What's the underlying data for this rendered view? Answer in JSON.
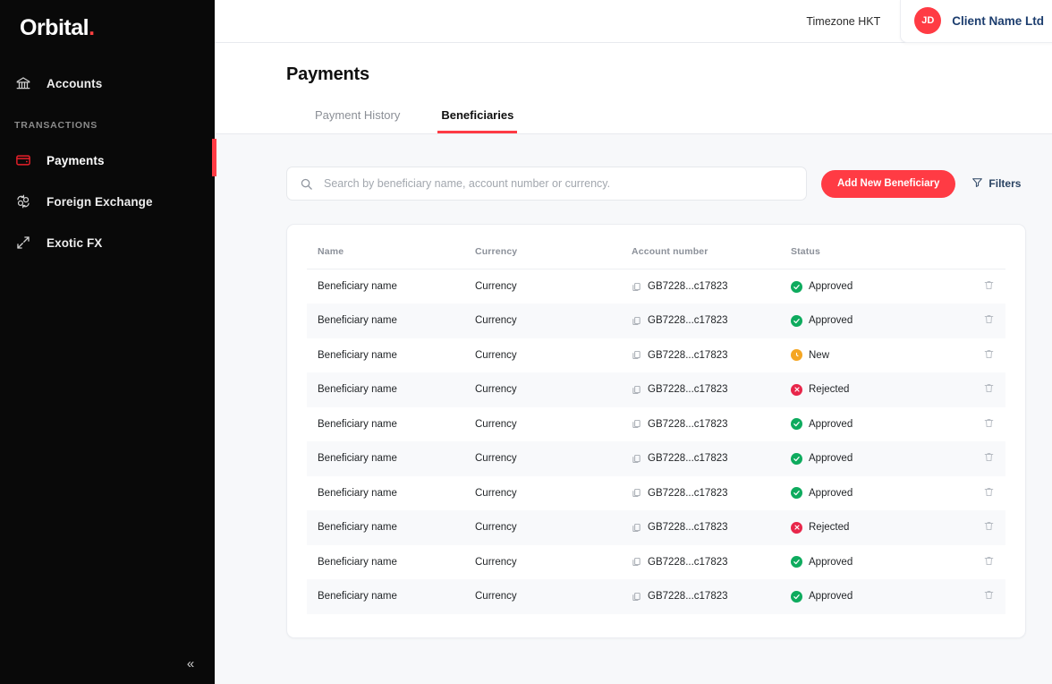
{
  "brand": {
    "name": "Orbital",
    "dot": "."
  },
  "sidebar": {
    "section_label": "TRANSACTIONS",
    "items": [
      {
        "label": "Accounts",
        "icon": "bank-icon"
      },
      {
        "label": "Payments",
        "icon": "wallet-icon"
      },
      {
        "label": "Foreign Exchange",
        "icon": "exchange-icon"
      },
      {
        "label": "Exotic FX",
        "icon": "expand-arrows-icon"
      }
    ],
    "collapse_label": "«"
  },
  "topbar": {
    "timezone": "Timezone HKT",
    "avatar_initials": "JD",
    "client_name": "Client Name Ltd"
  },
  "page": {
    "title": "Payments",
    "tabs": [
      {
        "label": "Payment History",
        "active": false
      },
      {
        "label": "Beneficiaries",
        "active": true
      }
    ]
  },
  "toolbar": {
    "search_placeholder": "Search by beneficiary name, account number or currency.",
    "search_value": "",
    "add_button": "Add New Beneficiary",
    "filters_label": "Filters"
  },
  "table": {
    "columns": [
      "Name",
      "Currency",
      "Account number",
      "Status"
    ],
    "rows": [
      {
        "name": "Beneficiary name",
        "currency": "Currency",
        "account": "GB7228...c17823",
        "status": "Approved",
        "status_kind": "approved"
      },
      {
        "name": "Beneficiary name",
        "currency": "Currency",
        "account": "GB7228...c17823",
        "status": "Approved",
        "status_kind": "approved"
      },
      {
        "name": "Beneficiary name",
        "currency": "Currency",
        "account": "GB7228...c17823",
        "status": "New",
        "status_kind": "new"
      },
      {
        "name": "Beneficiary name",
        "currency": "Currency",
        "account": "GB7228...c17823",
        "status": "Rejected",
        "status_kind": "rejected"
      },
      {
        "name": "Beneficiary name",
        "currency": "Currency",
        "account": "GB7228...c17823",
        "status": "Approved",
        "status_kind": "approved"
      },
      {
        "name": "Beneficiary name",
        "currency": "Currency",
        "account": "GB7228...c17823",
        "status": "Approved",
        "status_kind": "approved"
      },
      {
        "name": "Beneficiary name",
        "currency": "Currency",
        "account": "GB7228...c17823",
        "status": "Approved",
        "status_kind": "approved"
      },
      {
        "name": "Beneficiary name",
        "currency": "Currency",
        "account": "GB7228...c17823",
        "status": "Rejected",
        "status_kind": "rejected"
      },
      {
        "name": "Beneficiary name",
        "currency": "Currency",
        "account": "GB7228...c17823",
        "status": "Approved",
        "status_kind": "approved"
      },
      {
        "name": "Beneficiary name",
        "currency": "Currency",
        "account": "GB7228...c17823",
        "status": "Approved",
        "status_kind": "approved"
      }
    ]
  },
  "colors": {
    "brand_red": "#ff3b44",
    "sidebar_bg": "#090909",
    "approved": "#0eab5e",
    "new": "#f5a623",
    "rejected": "#e8264a",
    "client_blue": "#1c3d6e"
  }
}
